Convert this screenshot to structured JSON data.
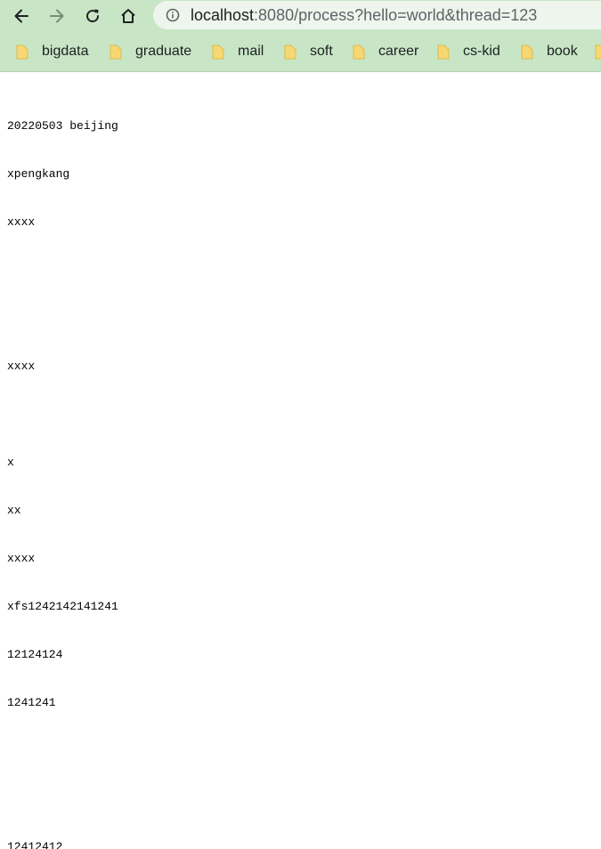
{
  "browser": {
    "url_host": "localhost",
    "url_rest": ":8080/process?hello=world&thread=123",
    "bookmarks": [
      {
        "label": "bigdata"
      },
      {
        "label": "graduate"
      },
      {
        "label": "mail"
      },
      {
        "label": "soft"
      },
      {
        "label": "career"
      },
      {
        "label": "cs-kid"
      },
      {
        "label": "book"
      }
    ]
  },
  "page": {
    "lines": [
      "20220503 beijing",
      "xpengkang",
      "xxxx",
      "",
      "",
      "xxxx",
      "",
      "x",
      "xx",
      "xxxx",
      "xfs1242142141241",
      "12124124",
      "1241241",
      "",
      "",
      "12412412"
    ]
  },
  "icons": {
    "back": "arrow-left-icon",
    "forward": "arrow-right-icon",
    "reload": "reload-icon",
    "home": "home-icon",
    "info": "info-icon",
    "folder": "folder-icon"
  },
  "colors": {
    "toolbar": "#c8e6c6",
    "omnibox": "#eef5ed",
    "folder": "#f7d774"
  }
}
